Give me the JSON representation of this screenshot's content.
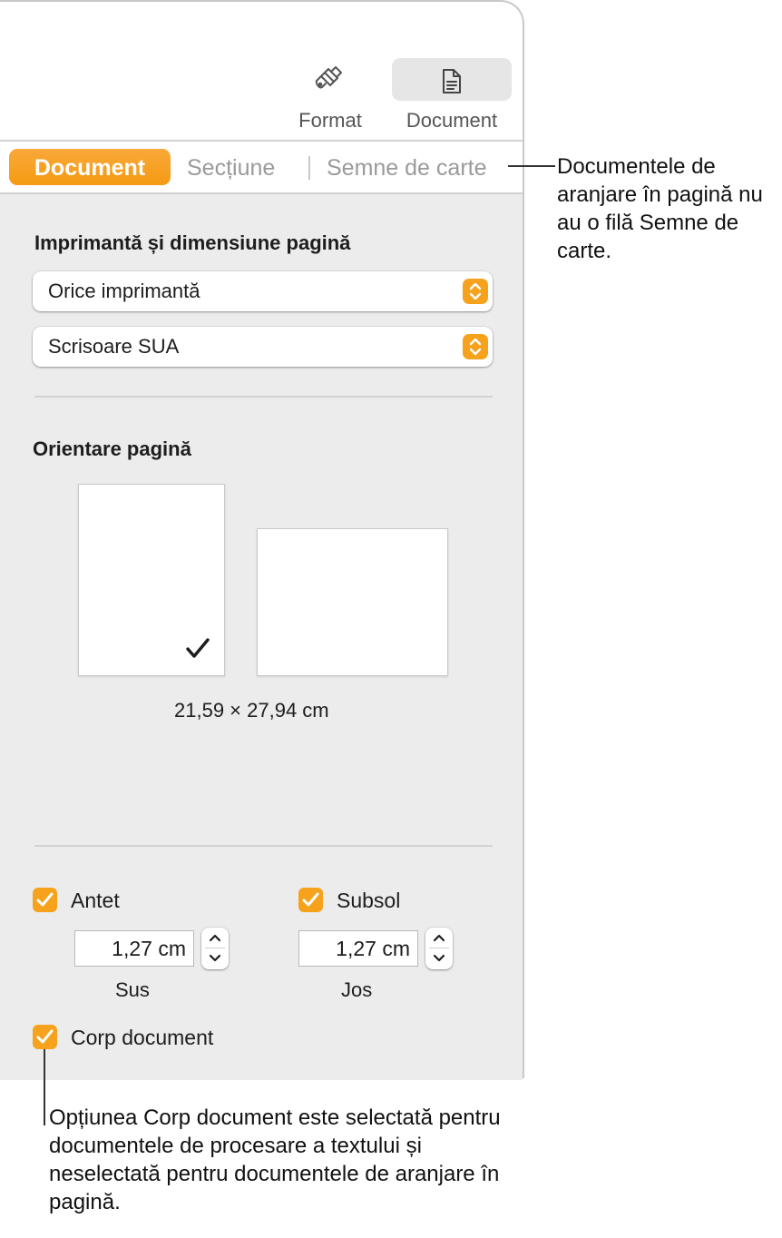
{
  "toolbar": {
    "format_label": "Format",
    "document_label": "Document",
    "format_icon": "paintbrush-icon",
    "document_icon": "document-icon"
  },
  "tabs": [
    {
      "label": "Document",
      "active": true
    },
    {
      "label": "Secțiune",
      "active": false
    },
    {
      "label": "Semne de carte",
      "active": false
    }
  ],
  "printer_section": {
    "heading": "Imprimantă și dimensiune pagină",
    "printer_value": "Orice imprimantă",
    "paper_value": "Scrisoare SUA"
  },
  "orientation": {
    "heading": "Orientare pagină",
    "selected": "portrait",
    "dimensions": "21,59 × 27,94 cm"
  },
  "header_footer": {
    "header_label": "Antet",
    "header_checked": true,
    "header_value": "1,27 cm",
    "header_sublabel": "Sus",
    "footer_label": "Subsol",
    "footer_checked": true,
    "footer_value": "1,27 cm",
    "footer_sublabel": "Jos",
    "body_label": "Corp document",
    "body_checked": true
  },
  "callouts": {
    "bookmarks": "Documentele de aranjare în pagină nu au o filă Semne de carte.",
    "body": "Opțiunea Corp document este selectată pentru documentele de procesare a textului și neselectată pentru documentele de aranjare în pagină."
  },
  "colors": {
    "accent": "#f6a21c",
    "panel_background": "#ececec"
  }
}
